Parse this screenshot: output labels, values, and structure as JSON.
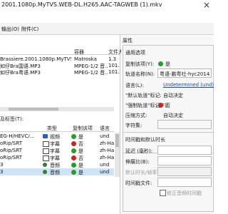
{
  "window": {
    "title": "2001.1080p.MyTVS.WEB-DL.H265.AAC-TAGWEB (1).mkv"
  },
  "menu": [
    "输出(O)",
    "附件(C)"
  ],
  "files": {
    "headers": [
      "",
      "容器",
      "文件大"
    ],
    "rows": [
      {
        "name": "Brassiere.2001.1080p.MyTVS.WEB-",
        "container": "Matroska",
        "size": "1.3"
      },
      {
        "name": "如仔Bra国语.MP3",
        "container": "MPEG-1/2 音...",
        "size": "101.3"
      },
      {
        "name": "如仔Bra粤语.MP3",
        "container": "MPEG-1/2 音...",
        "size": "101.3"
      }
    ]
  },
  "tracks": {
    "label": "及标签(T):",
    "headers": [
      "",
      "类型",
      "复制该项",
      "语言"
    ],
    "rows": [
      {
        "codec": "EG-H/HEVC/...",
        "type": "视频",
        "copy": "是",
        "lang": "und",
        "status": "ok",
        "kind": "video",
        "selected": false
      },
      {
        "codec": "oRip/SRT",
        "type": "字幕",
        "copy": "否",
        "lang": "zh-Hans",
        "status": "no",
        "kind": "text",
        "selected": false
      },
      {
        "codec": "oRip/SRT",
        "type": "字幕",
        "copy": "是",
        "lang": "zh-Hant",
        "status": "ok",
        "kind": "text",
        "selected": false
      },
      {
        "codec": "oRip/SRT",
        "type": "字幕",
        "copy": "否",
        "lang": "zh-Hans",
        "status": "no",
        "kind": "text",
        "selected": false
      },
      {
        "codec": "3",
        "type": "音频",
        "copy": "是",
        "lang": "und",
        "status": "ok",
        "kind": "audio",
        "selected": false
      },
      {
        "codec": "3",
        "type": "音频",
        "copy": "是",
        "lang": "und",
        "status": "ok",
        "kind": "audio",
        "selected": true
      }
    ]
  },
  "props": {
    "header": "属性",
    "general_title": "通用选项",
    "copy_label": "复制该项(Y):",
    "copy_value": "是",
    "track_name_label": "轨道名称(N):",
    "track_name_value": "粤语-鹏粤社-hyc2014",
    "language_label": "语言(L):",
    "language_value": "Undetermined (und)",
    "default_label": "\"默认轨道\"标记:",
    "default_value": "自动决定",
    "forced_label": "\"强制轨道\"标记(F):",
    "forced_value": "否",
    "compression_label": "压缩方式:",
    "compression_value": "自动决定",
    "encoding_label": "字符集:",
    "timing_title": "时间戳和默认时长",
    "delay_label": "延迟 (毫秒):",
    "stretch_label": "伸展比(B):",
    "default_duration_label": "默认时长/帧率:",
    "timestamp_file_label": "时间戳文件:",
    "fix_bitstream_label": "修正音频时间戳"
  },
  "colors": {
    "selection": "#cfe3f7",
    "ok": "#2e9a2e",
    "no": "#c62828",
    "link": "#1a49b5"
  }
}
